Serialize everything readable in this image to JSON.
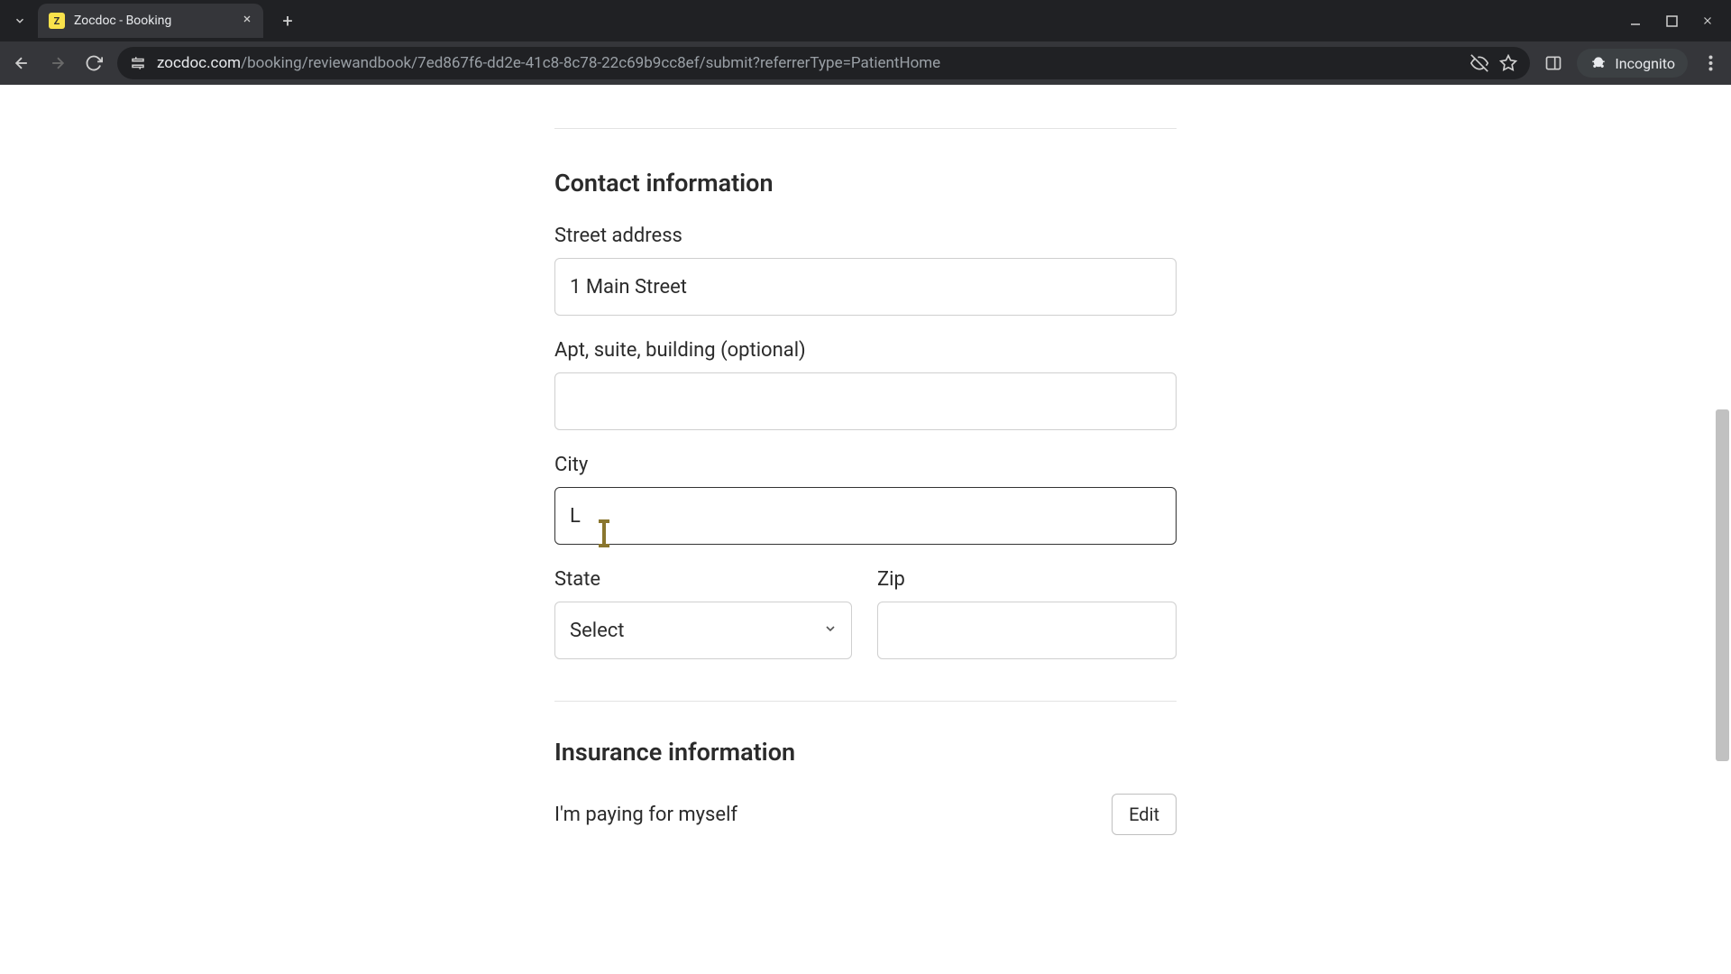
{
  "browser": {
    "tab_title": "Zocdoc - Booking",
    "url_host": "zocdoc.com",
    "url_path": "/booking/reviewandbook/7ed867f6-dd2e-41c8-8c78-22c69b9cc8ef/submit?referrerType=PatientHome",
    "incognito_label": "Incognito"
  },
  "form": {
    "contact_section_title": "Contact information",
    "street_label": "Street address",
    "street_value": "1 Main Street",
    "apt_label": "Apt, suite, building (optional)",
    "apt_value": "",
    "city_label": "City",
    "city_value": "L",
    "state_label": "State",
    "state_selected": "Select",
    "zip_label": "Zip",
    "zip_value": "",
    "insurance_section_title": "Insurance information",
    "insurance_text": "I'm paying for myself",
    "edit_button": "Edit"
  }
}
